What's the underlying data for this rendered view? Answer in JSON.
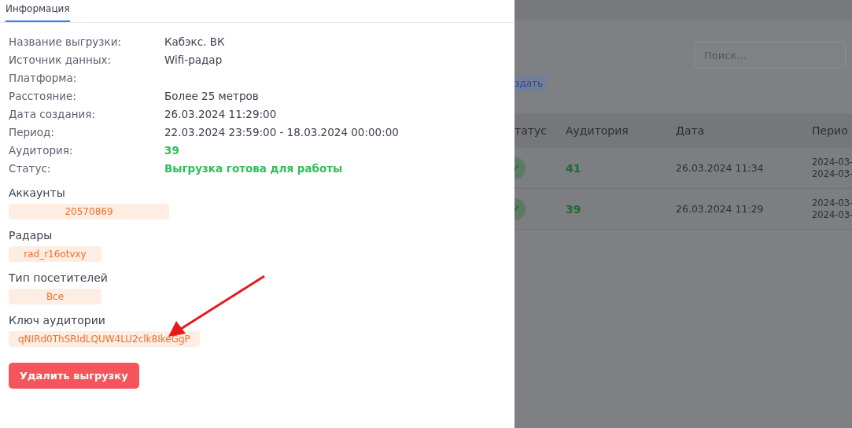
{
  "tabs": [
    {
      "label": "Информация",
      "selected": true
    }
  ],
  "details": [
    {
      "label": "Название выгрузки:",
      "value": "Кабэкс. ВК",
      "kind": "plain"
    },
    {
      "label": "Источник данных:",
      "value": "Wifi-радар",
      "kind": "plain"
    },
    {
      "label": "Платформа:"
    },
    {
      "label": "Расстояние:",
      "value": "Более 25 метров",
      "kind": "plain"
    },
    {
      "label": "Дата создания:",
      "value": "26.03.2024 11:29:00",
      "kind": "plain"
    },
    {
      "label": "Период:",
      "value": "22.03.2024 23:59:00 - 18.03.2024 00:00:00",
      "kind": "plain"
    },
    {
      "label": "Аудитория:",
      "value": "39",
      "kind": "success"
    },
    {
      "label": "Статус:",
      "value": "Выгрузка готова для работы",
      "kind": "success"
    }
  ],
  "sections": [
    {
      "title": "Аккаунты",
      "tags": [
        "20570869"
      ]
    },
    {
      "title": "Радары",
      "tags": [
        "rad_r16otvxy"
      ]
    },
    {
      "title": "Тип посетителей",
      "tags": [
        "Все"
      ]
    },
    {
      "title": "Ключ аудитории",
      "tags": [
        "qNIRd0ThSRIdLQUW4LU2clk8IkeGgP"
      ]
    }
  ],
  "delete_button": "Удалить выгрузку",
  "background": {
    "search": {
      "placeholder": "Поиск..."
    },
    "create_button": "здать",
    "table": {
      "columns": [
        "татус",
        "Аудитория",
        "Дата",
        "Перио"
      ],
      "rows": [
        {
          "status_ok": true,
          "audience": "41",
          "date": "26.03.2024 11:34",
          "period": [
            "2024-03-",
            "2024-03-"
          ]
        },
        {
          "status_ok": true,
          "audience": "39",
          "date": "26.03.2024 11:29",
          "period": [
            "2024-03-",
            "2024-03-"
          ]
        }
      ]
    }
  }
}
